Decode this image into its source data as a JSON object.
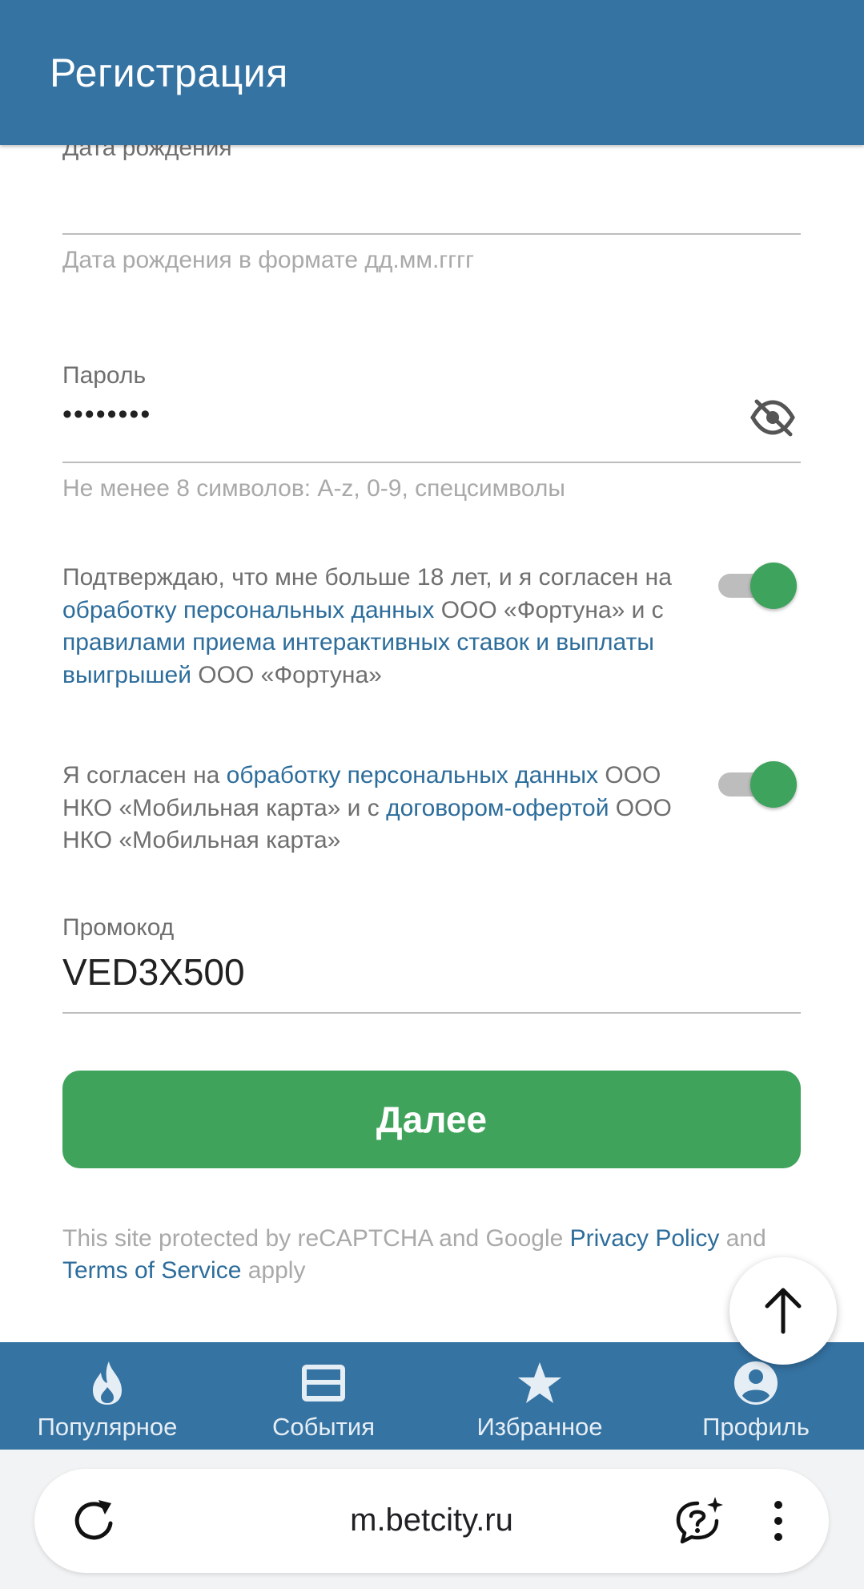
{
  "header": {
    "title": "Регистрация"
  },
  "birthdate": {
    "label": "Дата рождения",
    "value": "",
    "helper": "Дата рождения в формате дд.мм.гггг"
  },
  "password": {
    "label": "Пароль",
    "value": "••••••••",
    "helper": "Не менее 8 символов: A-z, 0-9, спецсимволы",
    "visibility_icon": "eye-off-icon"
  },
  "consent1": {
    "text_1": "Подтверждаю, что мне больше 18 лет, и я согласен на ",
    "link_1": "обработку персональных данных",
    "text_2": " ООО «Фортуна» и с ",
    "link_2": "правилами приема интерактивных ставок и выплаты выигрышей",
    "text_3": " ООО «Фортуна»",
    "toggle_on": true
  },
  "consent2": {
    "text_1": "Я согласен на ",
    "link_1": "обработку персональных данных",
    "text_2": " ООО НКО «Мобильная карта» и с ",
    "link_2": "договором-офертой",
    "text_3": " ООО НКО «Мобильная карта»",
    "toggle_on": true
  },
  "promo": {
    "label": "Промокод",
    "value": "VED3X500"
  },
  "next_button": {
    "label": "Далее"
  },
  "recaptcha": {
    "text_1": "This site protected by reCAPTCHA and Google ",
    "privacy_link": "Privacy Policy",
    "text_2": " and ",
    "terms_link": "Terms of Service",
    "text_3": " apply"
  },
  "bottom_nav": {
    "items": [
      {
        "label": "Популярное",
        "icon": "fire-icon"
      },
      {
        "label": "События",
        "icon": "events-icon"
      },
      {
        "label": "Избранное",
        "icon": "star-icon"
      },
      {
        "label": "Профиль",
        "icon": "profile-icon"
      }
    ]
  },
  "browser": {
    "url": "m.betcity.ru"
  },
  "colors": {
    "header": "#3573a3",
    "accent_green": "#40a35c",
    "link": "#2d6d9b",
    "helper_text": "#a9a9a9"
  }
}
